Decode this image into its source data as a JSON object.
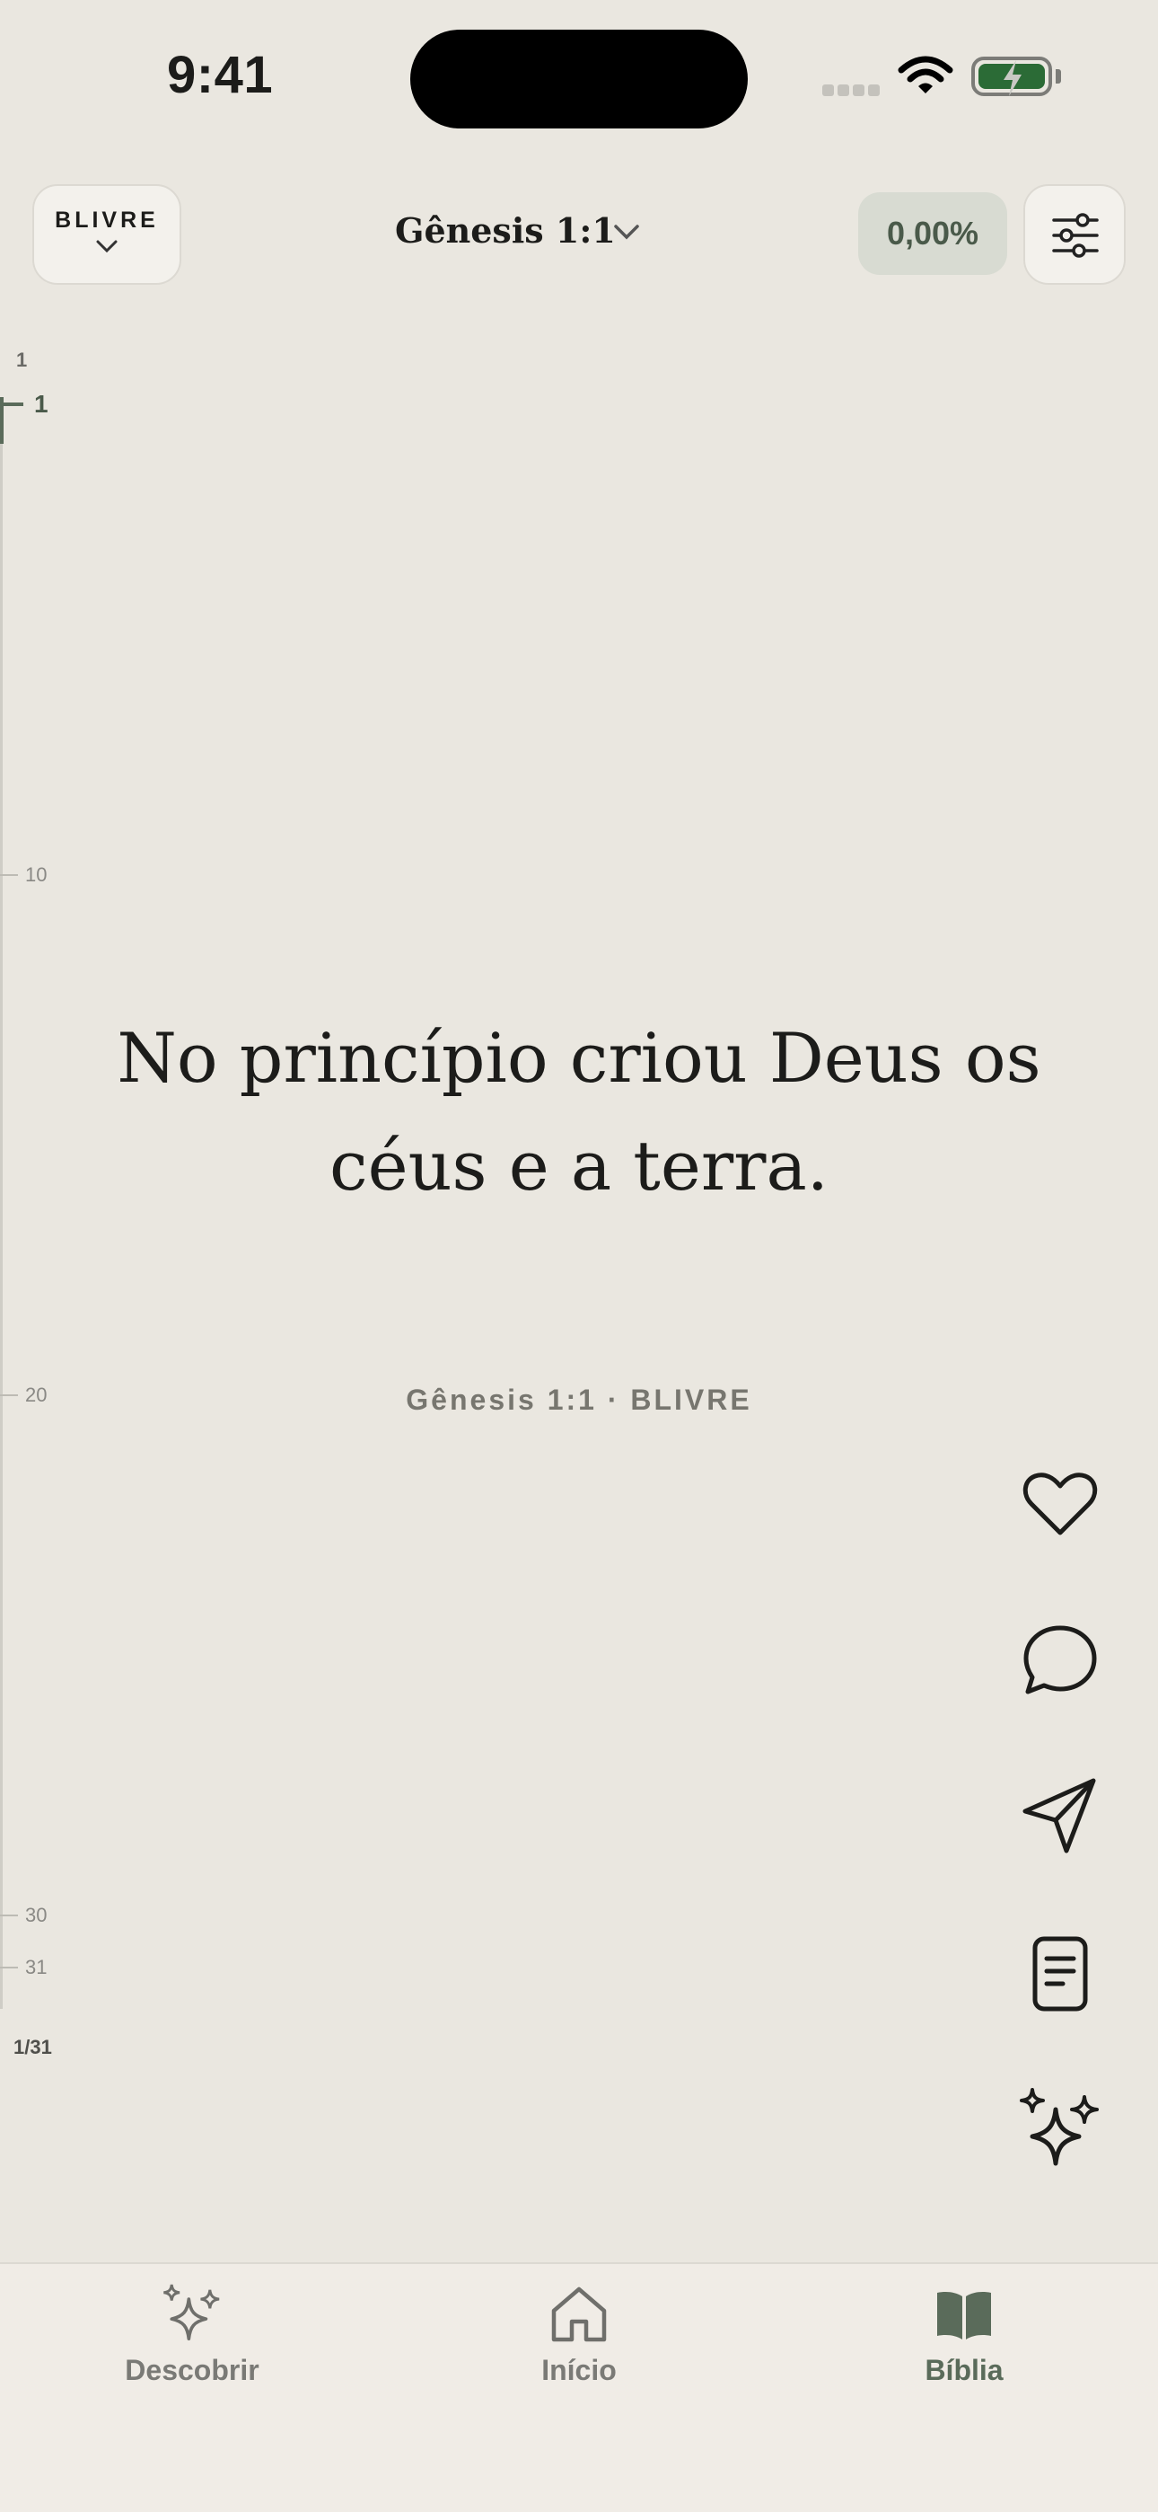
{
  "status_bar": {
    "time": "9:41"
  },
  "header": {
    "version_label": "BLIVRE",
    "reference": "Gênesis 1:1",
    "progress": "0,00%"
  },
  "scrubber": {
    "top_label": "1",
    "current_label": "1",
    "ticks": [
      "10",
      "20",
      "30",
      "31"
    ],
    "page_count": "1/31"
  },
  "verse": {
    "text": "No princípio criou Deus os céus e a terra.",
    "reference": "Gênesis 1:1 · BLIVRE"
  },
  "actions": [
    "heart-icon",
    "comment-icon",
    "share-icon",
    "notes-icon",
    "sparkles-icon"
  ],
  "tabs": [
    {
      "label": "Descobrir",
      "icon": "sparkles-icon",
      "active": false
    },
    {
      "label": "Início",
      "icon": "home-icon",
      "active": false
    },
    {
      "label": "Bíblia",
      "icon": "book-icon",
      "active": true
    }
  ],
  "colors": {
    "background": "#eae7e0",
    "accent": "#5a6b5a",
    "battery": "#2b6b36",
    "progress_pill": "#d8dbd2"
  }
}
